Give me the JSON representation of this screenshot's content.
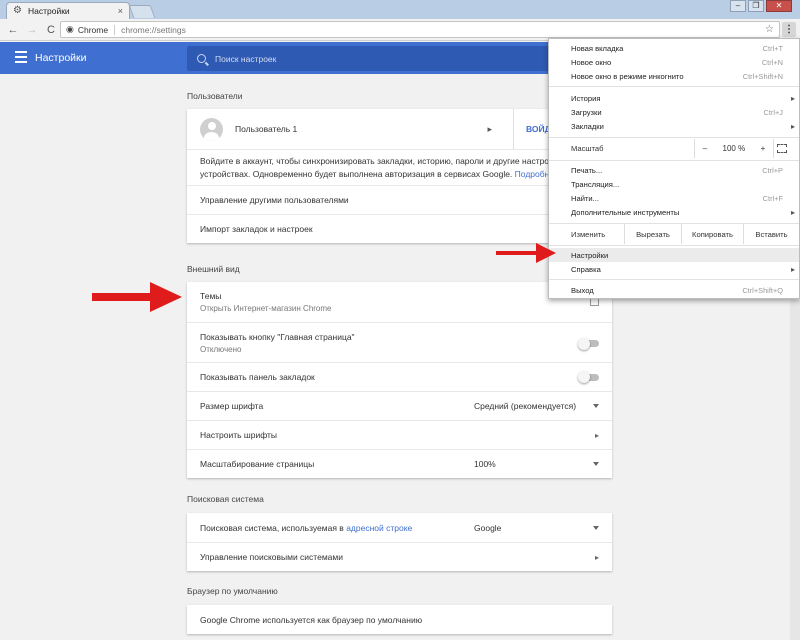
{
  "window": {
    "tab_title": "Настройки",
    "tab_close": "×",
    "controls": {
      "minimize": "–",
      "maximize": "❐",
      "close": "✕"
    }
  },
  "toolbar": {
    "back": "←",
    "forward": "→",
    "reload": "C",
    "site_name": "Chrome",
    "url": "chrome://settings",
    "star": "☆",
    "menu": "⋮"
  },
  "appbar": {
    "title": "Настройки",
    "search_placeholder": "Поиск настроек"
  },
  "sections": {
    "people": {
      "title": "Пользователи",
      "user_name": "Пользователь 1",
      "signin_label": "ВОЙДИ",
      "signin_text": "Войдите в аккаунт, чтобы синхронизировать закладки, историю, пароли и другие настройки",
      "signin_text2": "устройствах. Одновременно будет выполнена авторизация в сервисах Google.",
      "more_link": "Подробнее...",
      "manage_users": "Управление другими пользователями",
      "import": "Импорт закладок и настроек"
    },
    "appearance": {
      "title": "Внешний вид",
      "themes": "Темы",
      "themes_sub": "Открыть Интернет-магазин Chrome",
      "home_button": "Показывать кнопку \"Главная страница\"",
      "home_button_sub": "Отключено",
      "bookmarks_bar": "Показывать панель закладок",
      "font_size": "Размер шрифта",
      "font_size_value": "Средний (рекомендуется)",
      "customize_fonts": "Настроить шрифты",
      "page_zoom": "Масштабирование страницы",
      "page_zoom_value": "100%"
    },
    "search": {
      "title": "Поисковая система",
      "engine_label_pre": "Поисковая система, используемая в ",
      "engine_label_link": "адресной строке",
      "engine_value": "Google",
      "manage_engines": "Управление поисковыми системами"
    },
    "default_browser": {
      "title": "Браузер по умолчанию",
      "status": "Google Chrome используется как браузер по умолчанию"
    }
  },
  "menu": {
    "new_tab": {
      "label": "Новая вкладка",
      "shortcut": "Ctrl+T"
    },
    "new_window": {
      "label": "Новое окно",
      "shortcut": "Ctrl+N"
    },
    "incognito": {
      "label": "Новое окно в режиме инкогнито",
      "shortcut": "Ctrl+Shift+N"
    },
    "history": {
      "label": "История"
    },
    "downloads": {
      "label": "Загрузки",
      "shortcut": "Ctrl+J"
    },
    "bookmarks": {
      "label": "Закладки"
    },
    "zoom": {
      "label": "Масштаб",
      "minus": "–",
      "value": "100 %",
      "plus": "+"
    },
    "print": {
      "label": "Печать...",
      "shortcut": "Ctrl+P"
    },
    "cast": {
      "label": "Трансляция..."
    },
    "find": {
      "label": "Найти...",
      "shortcut": "Ctrl+F"
    },
    "more_tools": {
      "label": "Дополнительные инструменты"
    },
    "edit": {
      "label": "Изменить",
      "cut": "Вырезать",
      "copy": "Копировать",
      "paste": "Вставить"
    },
    "settings": {
      "label": "Настройки"
    },
    "help": {
      "label": "Справка"
    },
    "exit": {
      "label": "Выход",
      "shortcut": "Ctrl+Shift+Q"
    }
  },
  "colors": {
    "accent": "#3f6fd1",
    "annotation_arrow": "#e01b1b"
  },
  "icons": [
    "gear-icon",
    "back-icon",
    "forward-icon",
    "reload-icon",
    "star-icon",
    "menu-icon",
    "hamburger-icon",
    "search-icon",
    "avatar-icon",
    "external-link-icon",
    "chevron-right-icon",
    "dropdown-caret-icon",
    "fullscreen-icon",
    "red-arrow-icon"
  ]
}
